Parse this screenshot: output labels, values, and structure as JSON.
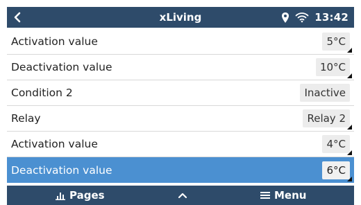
{
  "header": {
    "title": "xLiving",
    "time": "13:42",
    "colors": {
      "bar": "#2e4b6a",
      "text": "#ffffff"
    },
    "icons": {
      "back": "chevron-left-icon",
      "location": "location-pin-icon",
      "wifi": "wifi-icon"
    }
  },
  "rows": [
    {
      "label": "Activation value",
      "value": "5°C",
      "editable": true
    },
    {
      "label": "Deactivation value",
      "value": "10°C",
      "editable": true
    },
    {
      "label": "Condition 2",
      "value": "Inactive",
      "editable": false
    },
    {
      "label": "Relay",
      "value": "Relay 2",
      "editable": true
    },
    {
      "label": "Activation value",
      "value": "4°C",
      "editable": true
    },
    {
      "label": "Deactivation value",
      "value": "6°C",
      "editable": true,
      "selected": true
    }
  ],
  "selection_color": "#4b90d1",
  "footer": {
    "pages_label": "Pages",
    "menu_label": "Menu",
    "icons": {
      "pages": "bar-chart-icon",
      "up": "chevron-up-icon",
      "menu": "hamburger-menu-icon"
    }
  }
}
